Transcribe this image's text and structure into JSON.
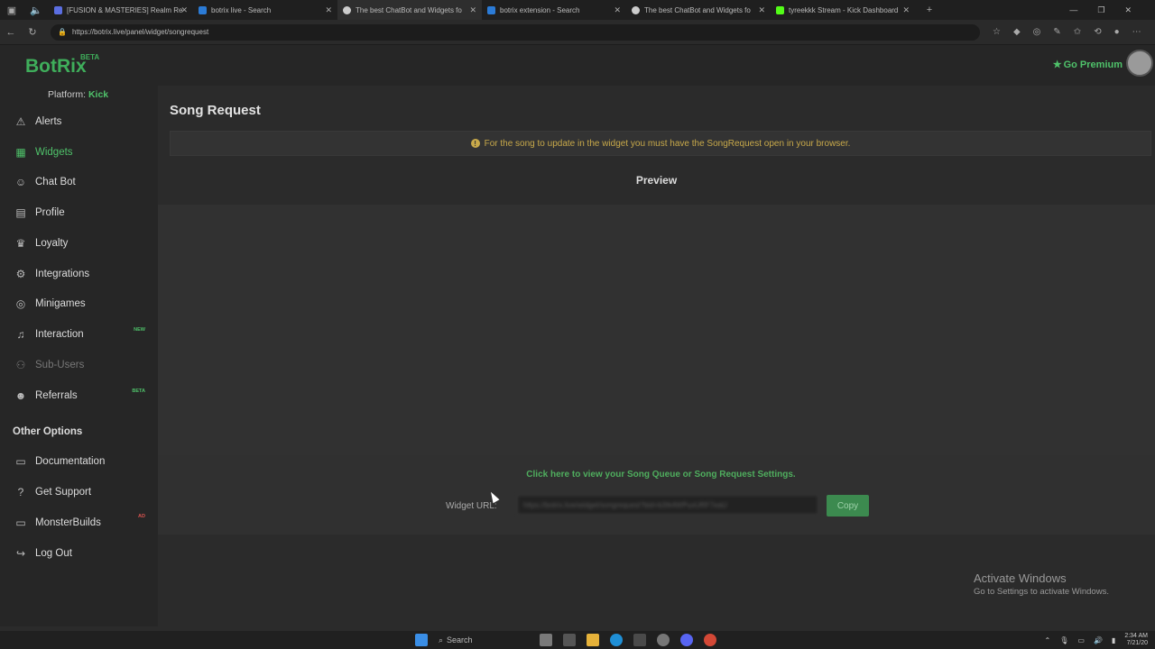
{
  "browser": {
    "tabs": [
      {
        "title": "[FUSION & MASTERIES] Realm Re",
        "fav": "#5b6ee1"
      },
      {
        "title": "botrix live - Search",
        "fav": "#2b7bd6"
      },
      {
        "title": "The best ChatBot and Widgets fo",
        "fav": "#cccccc"
      },
      {
        "title": "botrix extension - Search",
        "fav": "#2b7bd6"
      },
      {
        "title": "The best ChatBot and Widgets fo",
        "fav": "#cccccc"
      },
      {
        "title": "tyreekkk Stream - Kick Dashboard",
        "fav": "#53fc18"
      }
    ],
    "url": "https://botrix.live/panel/widget/songrequest"
  },
  "header": {
    "logo": "BotRix",
    "logo_badge": "BETA",
    "premium_label": "Go Premium"
  },
  "sidebar": {
    "platform_label": "Platform:",
    "platform_value": "Kick",
    "items": [
      {
        "label": "Alerts",
        "icon": "⚠"
      },
      {
        "label": "Widgets",
        "icon": "▦"
      },
      {
        "label": "Chat Bot",
        "icon": "☺"
      },
      {
        "label": "Profile",
        "icon": "▤"
      },
      {
        "label": "Loyalty",
        "icon": "♛"
      },
      {
        "label": "Integrations",
        "icon": "⚙"
      },
      {
        "label": "Minigames",
        "icon": "◎"
      },
      {
        "label": "Interaction",
        "icon": "♫",
        "badge": "NEW"
      },
      {
        "label": "Sub-Users",
        "icon": "⚇"
      },
      {
        "label": "Referrals",
        "icon": "☻",
        "badge": "BETA"
      }
    ],
    "other_title": "Other Options",
    "other_items": [
      {
        "label": "Documentation",
        "icon": "▭"
      },
      {
        "label": "Get Support",
        "icon": "?"
      },
      {
        "label": "MonsterBuilds",
        "icon": "▭",
        "badge": "AD"
      },
      {
        "label": "Log Out",
        "icon": "↪"
      }
    ]
  },
  "main": {
    "title": "Song Request",
    "notice": "For the song to update in the widget you must have the SongRequest open in your browser.",
    "preview_title": "Preview",
    "queue_link": "Click here to view your Song Queue or Song Request Settings.",
    "widget_url_label": "Widget URL:",
    "widget_url_value": "https://botrix.live/widget/songrequest?bid=b3Ik4WPuxURF7eaU",
    "copy_label": "Copy"
  },
  "watermark": {
    "title": "Activate Windows",
    "subtitle": "Go to Settings to activate Windows."
  },
  "taskbar": {
    "search_label": "Search",
    "time": "2:34 AM",
    "date": "7/21/20"
  },
  "colors": {
    "accent": "#3fae5b",
    "notice": "#c8a94a",
    "badge_new": "#4fc26a",
    "badge_beta": "#4fc26a",
    "badge_ad": "#d9534f"
  }
}
